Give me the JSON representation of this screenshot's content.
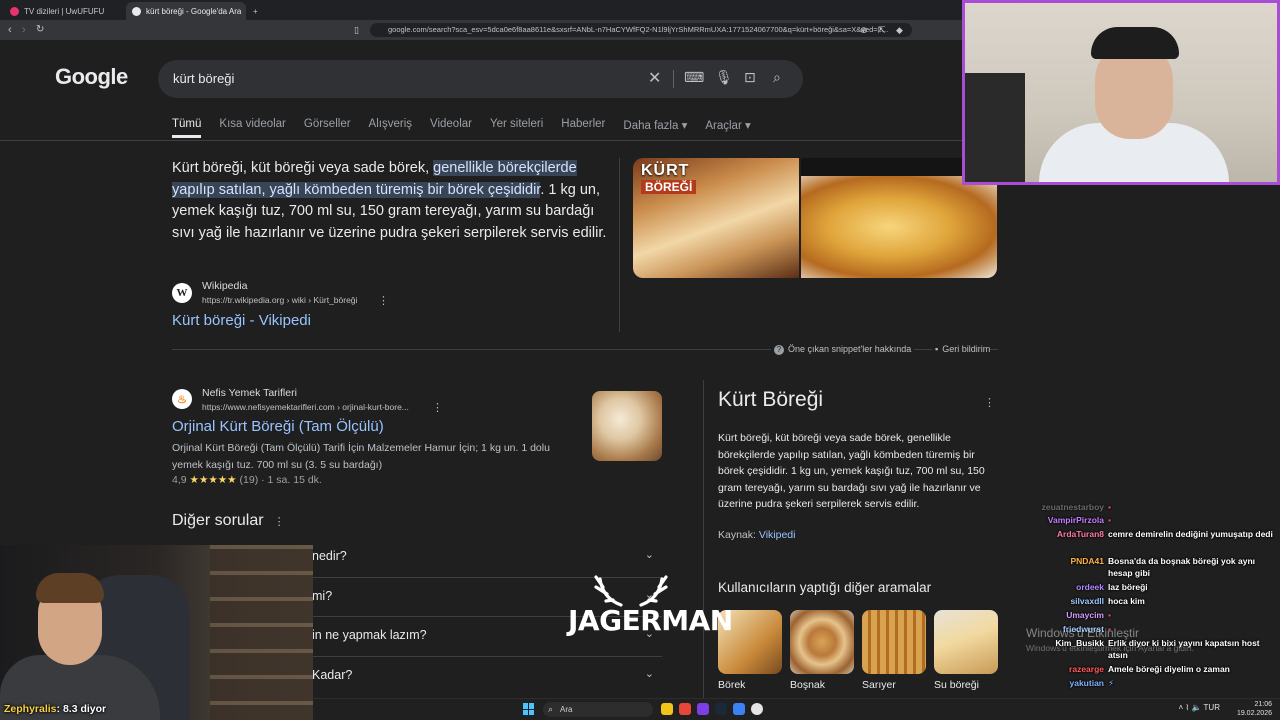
{
  "browser": {
    "tabs": [
      {
        "label": "TV dizileri | UwUFUFU",
        "active": false
      },
      {
        "label": "kürt böreği - Google'da Ara",
        "active": true
      }
    ],
    "new_tab_glyph": "+",
    "url": "google.com/search?sca_esv=5dca0e6f8aa8611e&sxsrf=ANbL-n7HaCYWfFQ2-N1l9ljYrShMRRmUXA:1771524067700&q=kürt+böreği&sa=X&ved=2..."
  },
  "google": {
    "logo": "Google",
    "search_query": "kürt böreği",
    "tabs": [
      "Tümü",
      "Kısa videolar",
      "Görseller",
      "Alışveriş",
      "Videolar",
      "Yer siteleri",
      "Haberler",
      "Daha fazla ▾",
      "Araçlar ▾"
    ]
  },
  "snippet": {
    "text_before": "Kürt böreği, küt böreği veya sade börek, ",
    "text_highlight": "genellikle börekçilerde yapılıp satılan, yağlı kömbeden türemiş bir börek çeşididir",
    "text_after": ". 1 kg un, yemek kaşığı tuz, 700 ml su, 150 gram tereyağı, yarım su bardağı sıvı yağ ile hazırlanır ve üzerine pudra şekeri serpilerek servis edilir.",
    "image_label_line1": "KÜRT",
    "image_label_line2": "BÖREĞİ",
    "source_name": "Wikipedia",
    "source_icon_letter": "W",
    "source_url": "https://tr.wikipedia.org › wiki › Kürt_böreği",
    "title": "Kürt böreği - Vikipedi",
    "about_label": "Öne çıkan snippet'ler hakkında",
    "feedback_label": "Geri bildirim"
  },
  "result2": {
    "site_name": "Nefis Yemek Tarifleri",
    "site_url": "https://www.nefisyemektarifleri.com › orjinal-kurt-bore...",
    "title": "Orjinal Kürt Böreği (Tam Ölçülü)",
    "description": "Orjinal Kürt Böreği (Tam Ölçülü) Tarifi İçin Malzemeler Hamur İçin; 1 kg un. 1 dolu yemek kaşığı tuz. 700 ml su (3. 5 su bardağı)",
    "rating_value": "4,9",
    "rating_count": "(19)",
    "duration": "· 1 sa. 15 dk."
  },
  "paa": {
    "title": "Diğer sorular",
    "questions": [
      "nedir?",
      "mi?",
      "in ne yapmak lazım?",
      "Kadar?"
    ]
  },
  "knowledge_panel": {
    "title": "Kürt Böreği",
    "description": "Kürt böreği, küt böreği veya sade börek, genellikle börekçilerde yapılıp satılan, yağlı kömbeden türemiş bir börek çeşididir. 1 kg un, yemek kaşığı tuz, 700 ml su, 150 gram tereyağı, yarım su bardağı sıvı yağ ile hazırlanır ve üzerine pudra şekeri serpilerek servis edilir.",
    "source_label": "Kaynak:",
    "source_link": "Vikipedi",
    "related_title": "Kullanıcıların yaptığı diğer aramalar",
    "related": [
      "Börek",
      "Boşnak",
      "Sarıyer",
      "Su böreği"
    ]
  },
  "overlay": {
    "streamer_name": "Zephyralis",
    "streamer_text": ": 8.3 diyor",
    "logo_text": "JAGERMAN"
  },
  "chat": [
    {
      "user": "zeuatnestarboy",
      "msg": "",
      "color": "#9a9a9a"
    },
    {
      "user": "VampirPirzola",
      "msg": "",
      "color": "#c77dff"
    },
    {
      "user": "ArdaTuran8",
      "msg": "cemre demirelin dediğini yumuşatıp dedi",
      "color": "#ff7aa2"
    },
    {
      "user": "PNDA41",
      "msg": "Bosna'da da boşnak böreği yok aynı hesap gibi",
      "color": "#ffb347"
    },
    {
      "user": "ordeek",
      "msg": "laz böreği",
      "color": "#b388ff"
    },
    {
      "user": "silvaxdll",
      "msg": "hoca kim",
      "color": "#9ec9ff"
    },
    {
      "user": "Umaycim",
      "msg": "",
      "color": "#d59cff"
    },
    {
      "user": "friedwurst",
      "msg": "",
      "color": "#9ec9ff"
    },
    {
      "user": "Kim_Busikk",
      "msg": "Erlik diyor ki bixi yayını kapatsın host atsın",
      "color": "#ffffff"
    },
    {
      "user": "razearge",
      "msg": "Amele böreği diyelim o zaman",
      "color": "#ff5a5a"
    },
    {
      "user": "yakutian",
      "msg": "",
      "color": "#7fb3ff"
    }
  ],
  "watermark": {
    "line1": "Windows'u Etkinleştir",
    "line2": "Windows'u etkinleştirmek için Ayarlar'a gidin."
  },
  "taskbar": {
    "search_placeholder": "Ara",
    "language": "TUR",
    "time": "21:06",
    "date": "19.02.2026"
  }
}
